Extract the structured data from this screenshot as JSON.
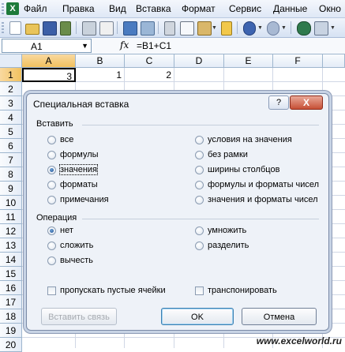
{
  "menu": [
    "Файл",
    "Правка",
    "Вид",
    "Вставка",
    "Формат",
    "Сервис",
    "Данные",
    "Окно"
  ],
  "namebox": {
    "value": "A1"
  },
  "formula": {
    "fx": "fx",
    "value": "=B1+C1"
  },
  "columns": [
    "A",
    "B",
    "C",
    "D",
    "E",
    "F"
  ],
  "rows": [
    "1",
    "2",
    "3",
    "4",
    "5",
    "6",
    "7",
    "8",
    "9",
    "10",
    "11",
    "12",
    "13",
    "14",
    "15",
    "16",
    "17",
    "18",
    "19",
    "20"
  ],
  "cells": {
    "A1": "3",
    "B1": "1",
    "C1": "2"
  },
  "dialog": {
    "title": "Специальная вставка",
    "help": "?",
    "close": "X",
    "paste_group": "Вставить",
    "paste_options_left": [
      "все",
      "формулы",
      "значения",
      "форматы",
      "примечания"
    ],
    "paste_options_right": [
      "условия на значения",
      "без рамки",
      "ширины столбцов",
      "формулы и форматы чисел",
      "значения и форматы чисел"
    ],
    "paste_selected": "значения",
    "operation_group": "Операция",
    "operation_left": [
      "нет",
      "сложить",
      "вычесть"
    ],
    "operation_right": [
      "умножить",
      "разделить"
    ],
    "operation_selected": "нет",
    "skip_blanks": "пропускать пустые ячейки",
    "transpose": "транспонировать",
    "paste_link": "Вставить связь",
    "ok": "OK",
    "cancel": "Отмена"
  },
  "watermark": "www.excelworld.ru"
}
